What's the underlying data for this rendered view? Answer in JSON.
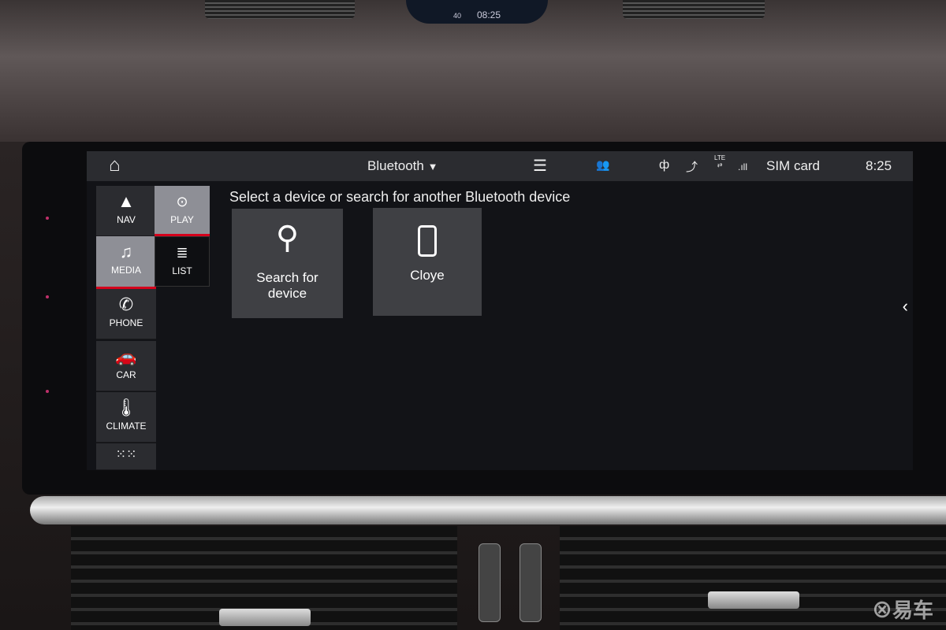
{
  "cluster": {
    "time": "08:25",
    "speed_tick": "40"
  },
  "status_bar": {
    "source": "Bluetooth",
    "sim": "SIM card",
    "time": "8:25",
    "network": "LTE"
  },
  "sidebar": [
    {
      "label": "NAV",
      "icon": "navigation-arrow-icon"
    },
    {
      "label": "MEDIA",
      "icon": "music-note-icon",
      "active": true
    },
    {
      "label": "PHONE",
      "icon": "phone-icon"
    },
    {
      "label": "CAR",
      "icon": "car-icon"
    },
    {
      "label": "CLIMATE",
      "icon": "thermometer-icon"
    },
    {
      "label": "",
      "icon": "apps-grid-icon"
    }
  ],
  "submenu": [
    {
      "label": "PLAY",
      "icon": "play-circle-icon",
      "active": true
    },
    {
      "label": "LIST",
      "icon": "list-icon"
    }
  ],
  "main": {
    "heading": "Select a device or search for another Bluetooth device",
    "tiles": [
      {
        "label": "Search for device",
        "icon": "search-icon"
      },
      {
        "label": "Cloye",
        "icon": "smartphone-icon"
      }
    ]
  },
  "accent": "#d5001c",
  "watermark": "易车"
}
